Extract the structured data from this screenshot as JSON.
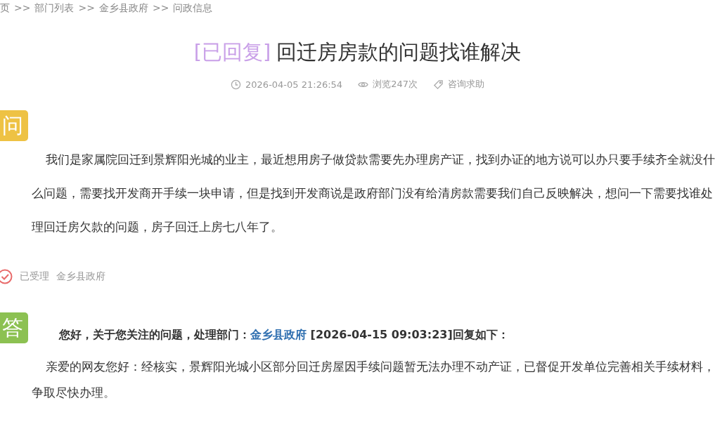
{
  "breadcrumb": [
    "页",
    ">>",
    "部门列表",
    ">>",
    "金乡县政府",
    ">>",
    "问政信息"
  ],
  "title": {
    "status": "[已回复]",
    "text": "回迁房房款的问题找谁解决"
  },
  "meta": {
    "time": "2026-04-05 21:26:54",
    "views": "浏览247次",
    "category": "咨询求助"
  },
  "question": {
    "badge": "问",
    "body": "我们是家属院回迁到景辉阳光城的业主，最近想用房子做贷款需要先办理房产证，找到办证的地方说可以办只要手续齐全就没什么问题，需要找开发商开手续一块申请，但是找到开发商说是政府部门没有给清房款需要我们自己反映解决，想问一下需要找谁处理回迁房欠款的问题，房子回迁上房七八年了。"
  },
  "status": {
    "label": "已受理",
    "department": "金乡县政府"
  },
  "answer": {
    "badge": "答",
    "header_before": "您好，关于您关注的问题，处理部门：",
    "header_link": "金乡县政府",
    "header_after": " [2026-04-15 09:03:23]回复如下：",
    "body": "亲爱的网友您好：经核实，景辉阳光城小区部分回迁房屋因手续问题暂无法办理不动产证，已督促开发单位完善相关手续材料，争取尽快办理。"
  }
}
